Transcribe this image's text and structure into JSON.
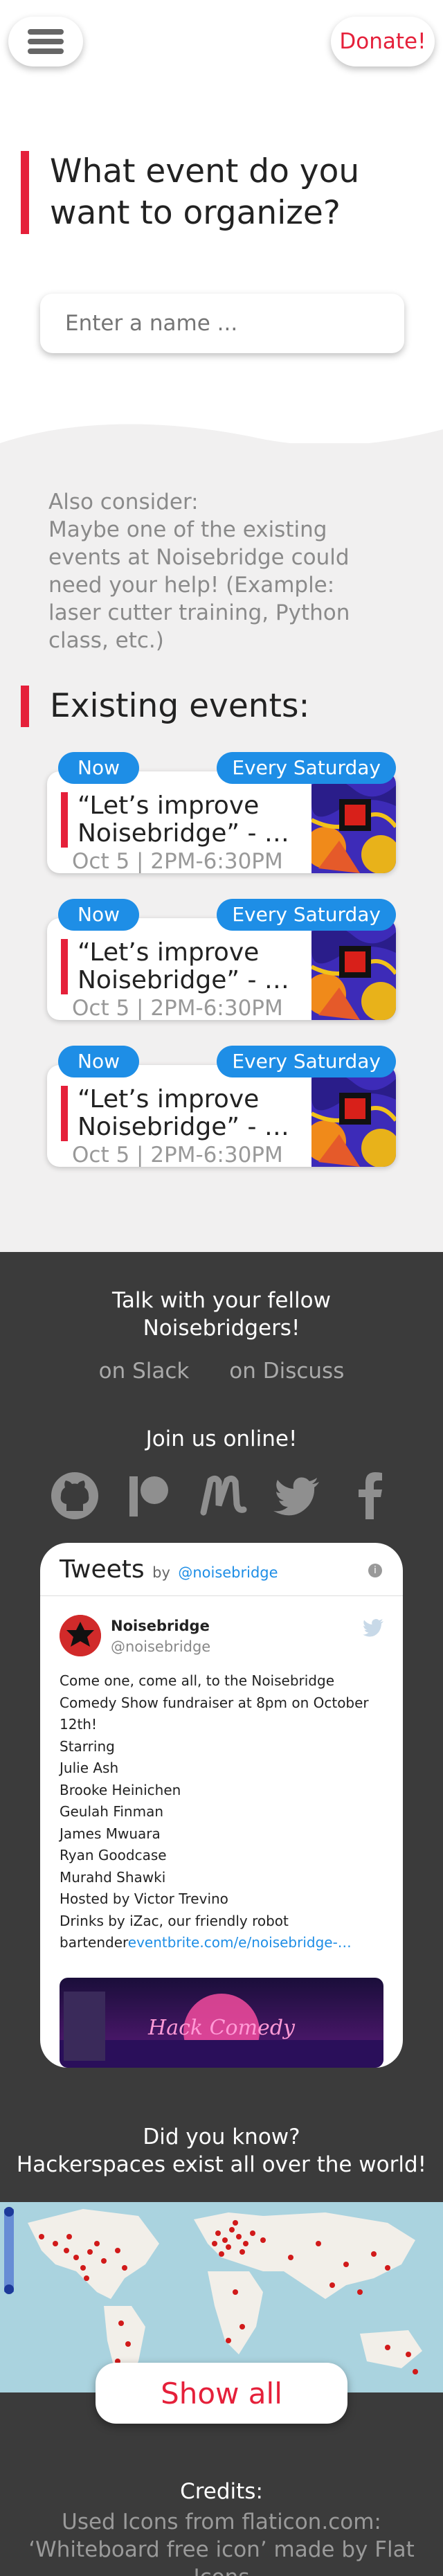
{
  "header": {
    "menu_icon": "hamburger-menu-icon",
    "donate_label": "Donate!"
  },
  "colors": {
    "accent": "#e5203a",
    "tag_blue": "#1e8ee6",
    "dark_bg": "#3b3b3b",
    "page_bg": "#f1f0f0"
  },
  "hero": {
    "question": "What event do you want to organize?",
    "name_placeholder": "Enter a name ..."
  },
  "consider": {
    "text": "Also consider:\nMaybe one of the existing events at Noisebridge could need your help! (Example: laser cutter training, Python class, etc.)"
  },
  "existing": {
    "title": "Existing events:",
    "events": [
      {
        "tag_now": "Now",
        "tag_every": "Every Saturday",
        "title": "“Let’s improve Noisebridge” - …",
        "time": "Oct 5 | 2PM-6:30PM"
      },
      {
        "tag_now": "Now",
        "tag_every": "Every Saturday",
        "title": "“Let’s improve Noisebridge” - …",
        "time": "Oct 5 | 2PM-6:30PM"
      },
      {
        "tag_now": "Now",
        "tag_every": "Every Saturday",
        "title": "“Let’s improve Noisebridge” - …",
        "time": "Oct 5 | 2PM-6:30PM"
      }
    ]
  },
  "community": {
    "talk": "Talk with your fellow Noisebridgers!",
    "slack": "on Slack",
    "discuss": "on Discuss",
    "join": "Join us online!",
    "social_icons": [
      "github-icon",
      "patreon-icon",
      "meetup-icon",
      "twitter-icon",
      "facebook-icon"
    ]
  },
  "tweets": {
    "title": "Tweets",
    "by": "by",
    "handle_link": "@noisebridge",
    "author_name": "Noisebridge",
    "author_handle": "@noisebridge",
    "body": "Come one, come all, to the Noisebridge Comedy Show fundraiser at 8pm on October 12th!\nStarring\nJulie Ash\nBrooke Heinichen\nGeulah Finman\nJames Mwuara\nRyan Goodcase\nMurahd Shawki\nHosted by Victor Trevino\nDrinks by iZac, our friendly robot bartender",
    "link": "eventbrite.com/e/noisebridge-…",
    "image_title": "Hack Comedy"
  },
  "hackerspaces": {
    "text": "Did you know?\nHackerspaces exist all over the world!",
    "show_all": "Show all"
  },
  "credits": {
    "title": "Credits:",
    "text": "Used Icons from flaticon.com:\n‘Whiteboard free icon’ made by Flat Icons"
  }
}
